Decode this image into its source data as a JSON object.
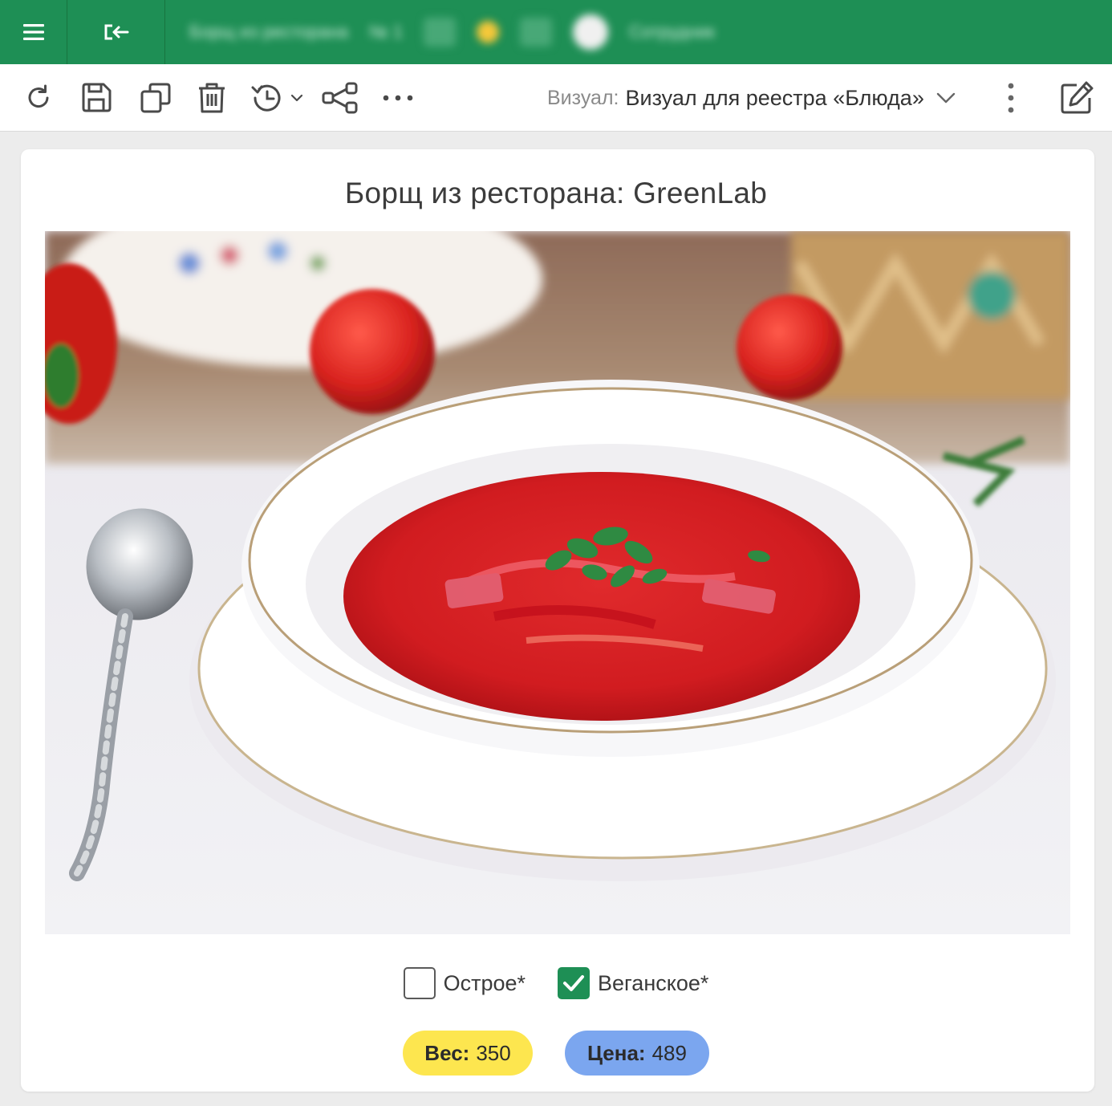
{
  "topbar": {
    "menu_icon": "hamburger-menu-icon",
    "back_icon": "exit-arrow-icon",
    "blurred_text_1": "Борщ из ресторана",
    "blurred_text_2": "№ 1",
    "blurred_user": "Сотрудник",
    "accent_color": "#1e8f55"
  },
  "toolbar": {
    "icons": [
      "refresh-icon",
      "save-icon",
      "copy-icon",
      "delete-icon",
      "history-icon",
      "share-icon",
      "more-icon"
    ],
    "visual_label": "Визуал:",
    "visual_value": "Визуал для реестра «Блюда»",
    "edit_icon": "edit-icon"
  },
  "card": {
    "title": "Борщ из ресторана: GreenLab",
    "checkboxes": [
      {
        "label": "Острое*",
        "checked": false
      },
      {
        "label": "Веганское*",
        "checked": true
      }
    ],
    "weight": {
      "label": "Вес:",
      "value": "350",
      "color": "#fde64f"
    },
    "price": {
      "label": "Цена:",
      "value": "489",
      "color": "#7ba6ef"
    }
  }
}
